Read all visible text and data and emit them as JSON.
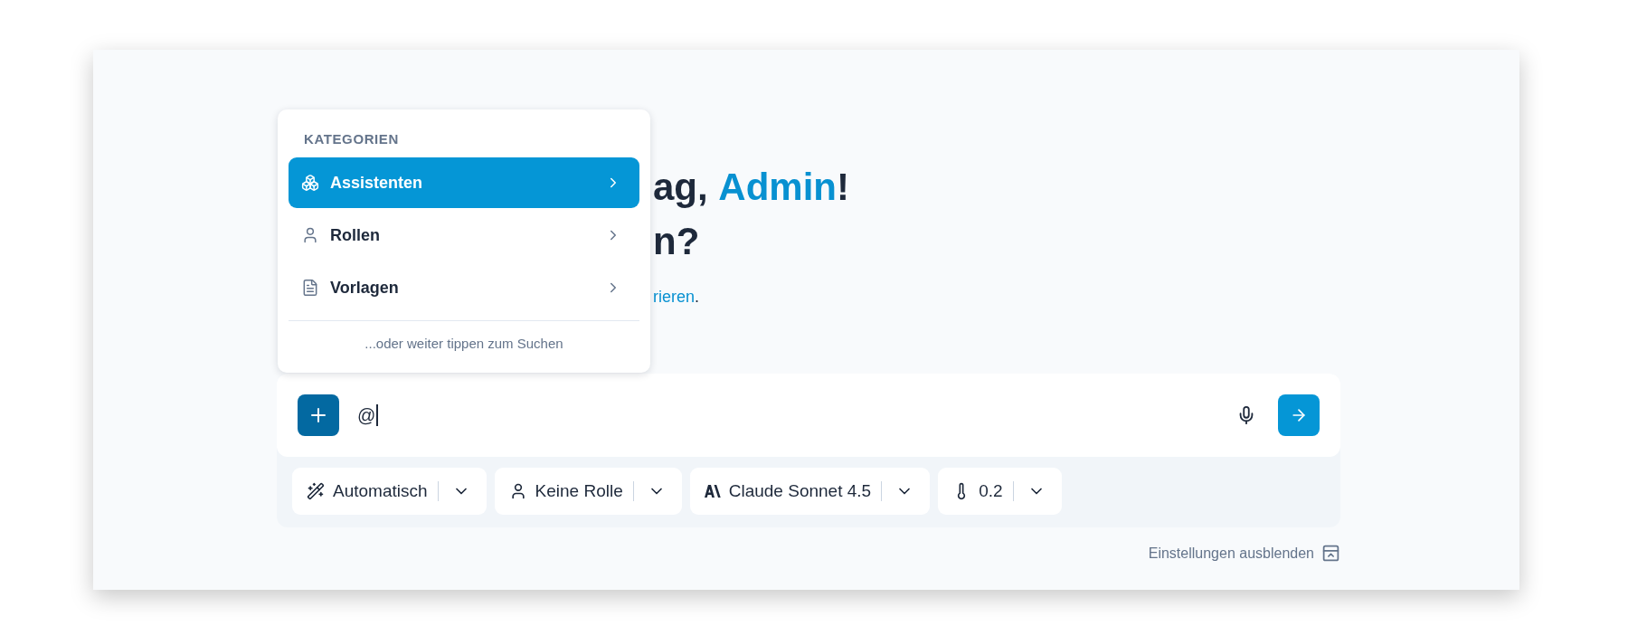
{
  "greeting": {
    "line_1": {
      "prefix": "ag, ",
      "name": "Admin",
      "suffix": "!"
    },
    "line_2": "n?"
  },
  "subtitle": {
    "link": "rieren",
    "suffix": "."
  },
  "category_menu": {
    "header": "KATEGORIEN",
    "items": [
      {
        "kind": "assistants",
        "label": "Assistenten",
        "selected": true
      },
      {
        "kind": "roles",
        "label": "Rollen",
        "selected": false
      },
      {
        "kind": "templates",
        "label": "Vorlagen",
        "selected": false
      }
    ],
    "hint": "...oder weiter tippen zum Suchen"
  },
  "composer": {
    "value": "@"
  },
  "settings": [
    {
      "kind": "mode",
      "label": "Automatisch"
    },
    {
      "kind": "role",
      "label": "Keine Rolle"
    },
    {
      "kind": "model",
      "label": "Claude Sonnet 4.5"
    },
    {
      "kind": "temperature",
      "label": "0.2"
    }
  ],
  "settings_toggle": "Einstellungen ausblenden"
}
